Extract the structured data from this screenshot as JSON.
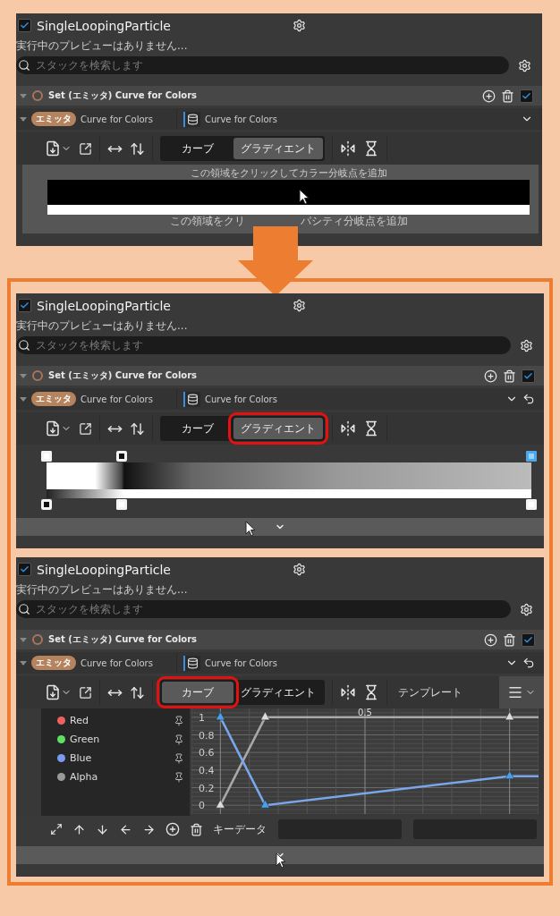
{
  "panels": [
    {
      "kind": "gradient_empty",
      "emitter": {
        "name": "SingleLoopingParticle",
        "checked": true
      },
      "status": "実行中のプレビューはありません...",
      "search": {
        "placeholder": "スタックを検索します"
      },
      "module": {
        "title": "Set (エミッタ) Curve for Colors",
        "enabled": true
      },
      "parameter": {
        "badge": "エミッタ",
        "name": "Curve for Colors",
        "value": "Curve for Colors",
        "reset": false
      },
      "view_tabs": [
        {
          "label": "カーブ",
          "selected": false,
          "highlighted": false
        },
        {
          "label": "グラディエント",
          "selected": true,
          "highlighted": false
        }
      ],
      "color_hint": "この領域をクリックしてカラー分岐点を追加",
      "opacity_hint": [
        "この領域をクリ",
        "パシティ分岐点を追加"
      ]
    },
    {
      "kind": "gradient",
      "emitter": {
        "name": "SingleLoopingParticle",
        "checked": true
      },
      "status": "実行中のプレビューはありません...",
      "search": {
        "placeholder": "スタックを検索します"
      },
      "module": {
        "title": "Set (エミッタ) Curve for Colors",
        "enabled": true
      },
      "parameter": {
        "badge": "エミッタ",
        "name": "Curve for Colors",
        "value": "Curve for Colors",
        "reset": true
      },
      "view_tabs": [
        {
          "label": "カーブ",
          "selected": false,
          "highlighted": false
        },
        {
          "label": "グラディエント",
          "selected": true,
          "highlighted": true
        }
      ],
      "color_stops": [
        {
          "level": 0,
          "selected": false
        },
        {
          "level": 0.155,
          "selected": false
        },
        {
          "level": 1,
          "selected": true
        }
      ],
      "opacity_stops": [
        {
          "level": 0,
          "selected": false
        },
        {
          "level": 0.155,
          "selected": false
        },
        {
          "level": 1,
          "selected": false
        }
      ]
    },
    {
      "kind": "curve",
      "emitter": {
        "name": "SingleLoopingParticle",
        "checked": true
      },
      "status": "実行中のプレビューはありません...",
      "search": {
        "placeholder": "スタックを検索します"
      },
      "module": {
        "title": "Set (エミッタ) Curve for Colors",
        "enabled": true
      },
      "parameter": {
        "badge": "エミッタ",
        "name": "Curve for Colors",
        "value": "Curve for Colors",
        "reset": true
      },
      "view_tabs": [
        {
          "label": "カーブ",
          "selected": true,
          "highlighted": true
        },
        {
          "label": "グラディエント",
          "selected": false,
          "highlighted": false
        }
      ],
      "template": "テンプレート",
      "channels": [
        {
          "name": "Red",
          "color": "#f06060"
        },
        {
          "name": "Green",
          "color": "#5ee060"
        },
        {
          "name": "Blue",
          "color": "#7a9cf0"
        },
        {
          "name": "Alpha",
          "color": "#9a9a9a"
        }
      ],
      "curve_editor": {
        "value_labels": [
          "1",
          "0.8",
          "0.6",
          "0.4",
          "0.2",
          "0"
        ],
        "time_label": "0.5"
      },
      "key_data_label": "キーデータ"
    }
  ]
}
